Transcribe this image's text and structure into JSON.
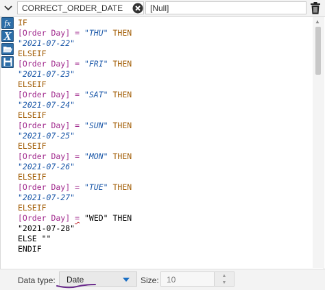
{
  "header": {
    "field_name": "CORRECT_ORDER_DATE",
    "type_value": "[Null]"
  },
  "toolbar": {
    "icons": [
      "function-icon",
      "variable-icon",
      "open-folder-icon",
      "save-icon"
    ]
  },
  "code": {
    "lines": [
      {
        "tokens": [
          {
            "t": "IF",
            "c": "kw"
          }
        ]
      },
      {
        "tokens": [
          {
            "t": "[Order Day]",
            "c": "fld"
          },
          {
            "t": " = ",
            "c": "op"
          },
          {
            "t": "\"THU\"",
            "c": "str"
          },
          {
            "t": " THEN",
            "c": "kw"
          }
        ]
      },
      {
        "tokens": [
          {
            "t": "\"2021-07-22\"",
            "c": "str"
          }
        ]
      },
      {
        "tokens": [
          {
            "t": "ELSEIF",
            "c": "kw"
          }
        ]
      },
      {
        "tokens": [
          {
            "t": "[Order Day]",
            "c": "fld"
          },
          {
            "t": " = ",
            "c": "op"
          },
          {
            "t": "\"FRI\"",
            "c": "str"
          },
          {
            "t": " THEN",
            "c": "kw"
          }
        ]
      },
      {
        "tokens": [
          {
            "t": "\"2021-07-23\"",
            "c": "str"
          }
        ]
      },
      {
        "tokens": [
          {
            "t": "ELSEIF",
            "c": "kw"
          }
        ]
      },
      {
        "tokens": [
          {
            "t": "[Order Day]",
            "c": "fld"
          },
          {
            "t": " = ",
            "c": "op"
          },
          {
            "t": "\"SAT\"",
            "c": "str"
          },
          {
            "t": " THEN",
            "c": "kw"
          }
        ]
      },
      {
        "tokens": [
          {
            "t": "\"2021-07-24\"",
            "c": "str"
          }
        ]
      },
      {
        "tokens": [
          {
            "t": "ELSEIF",
            "c": "kw"
          }
        ]
      },
      {
        "tokens": [
          {
            "t": "[Order Day]",
            "c": "fld"
          },
          {
            "t": " = ",
            "c": "op"
          },
          {
            "t": "\"SUN\"",
            "c": "str"
          },
          {
            "t": " THEN",
            "c": "kw"
          }
        ]
      },
      {
        "tokens": [
          {
            "t": "\"2021-07-25\"",
            "c": "str"
          }
        ]
      },
      {
        "tokens": [
          {
            "t": "ELSEIF",
            "c": "kw"
          }
        ]
      },
      {
        "tokens": [
          {
            "t": "[Order Day]",
            "c": "fld"
          },
          {
            "t": " = ",
            "c": "op"
          },
          {
            "t": "\"MON\"",
            "c": "str"
          },
          {
            "t": " THEN",
            "c": "kw"
          }
        ]
      },
      {
        "tokens": [
          {
            "t": "\"2021-07-26\"",
            "c": "str"
          }
        ]
      },
      {
        "tokens": [
          {
            "t": "ELSEIF",
            "c": "kw"
          }
        ]
      },
      {
        "tokens": [
          {
            "t": "[Order Day]",
            "c": "fld"
          },
          {
            "t": " = ",
            "c": "op"
          },
          {
            "t": "\"TUE\"",
            "c": "str"
          },
          {
            "t": " THEN",
            "c": "kw"
          }
        ]
      },
      {
        "tokens": [
          {
            "t": "\"2021-07-27\"",
            "c": "str"
          }
        ]
      },
      {
        "tokens": [
          {
            "t": "ELSEIF",
            "c": "kw"
          }
        ]
      },
      {
        "tokens": [
          {
            "t": "[Order Day]",
            "c": "fld"
          },
          {
            "t": " ",
            "c": ""
          },
          {
            "t": "=",
            "c": "op squig"
          },
          {
            "t": " \"WED\" THEN",
            "c": ""
          }
        ]
      },
      {
        "tokens": [
          {
            "t": "\"2021-07-28\"",
            "c": ""
          }
        ]
      },
      {
        "tokens": [
          {
            "t": "ELSE \"\"",
            "c": ""
          }
        ]
      },
      {
        "tokens": [
          {
            "t": "ENDIF",
            "c": ""
          }
        ]
      }
    ]
  },
  "footer": {
    "datatype_label": "Data type:",
    "datatype_value": "Date",
    "size_label": "Size:",
    "size_value": "10"
  },
  "colors": {
    "keyword": "#a05a00",
    "field": "#a0288c",
    "string": "#1a57a8",
    "tool_bg": "#2d6ea8",
    "underline": "#6a2a8c"
  }
}
